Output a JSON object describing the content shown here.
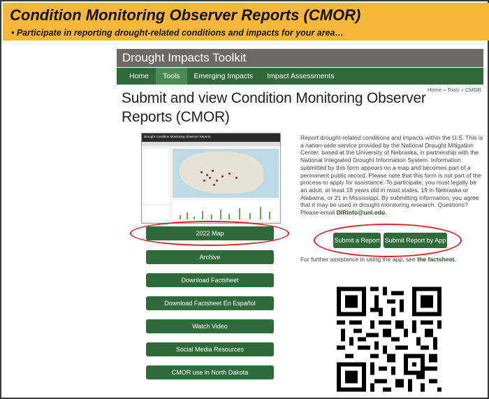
{
  "banner": {
    "title": "Condition Monitoring Observer Reports (CMOR)",
    "bullet": "•  Participate in reporting drought-related conditions and impacts for your area…",
    "color": "#f7b83a"
  },
  "site": {
    "toolkit_title": "Drought Impacts Toolkit",
    "nav": [
      "Home",
      "Tools",
      "Emerging Impacts",
      "Impact Assessments"
    ],
    "active_nav": "Tools",
    "breadcrumb": "Home  »  Tools  »  CMOR",
    "page_title": "Submit and view Condition Monitoring Observer Reports (CMOR)"
  },
  "screenshot": {
    "header": "Drought Condition Monitoring Observer Reports"
  },
  "buttons": [
    "2022 Map",
    "Archive",
    "Download Factsheet",
    "Download Factsheet En Español",
    "Watch Video",
    "Social Media Resources",
    "CMOR use in North Dakota"
  ],
  "description": {
    "text": "Report drought-related conditions and impacts within the U.S. This is a nation-wide service provided by the National Drought Mitigation Center, based at the University of Nebraska, in partnership with the National Integrated Drought Information System. Information submitted by this form appears on a map and becomes part of a permanent public record. Please note that this form is not part of the process to apply for assistance. To participate, you must legally be an adult, at least 18 years old in most states, 19 in Nebraska or Alabama, or 21 in Mississippi. By submitting information, you agree that it may be used in drought monitoring research. Questions? Please email ",
    "email": "DIRinfo@unl.edu",
    "email_suffix": "."
  },
  "report_buttons": {
    "submit": "Submit a Report",
    "submit_app": "Submit Report by App"
  },
  "help": {
    "prefix": "For further assistance in using the app, see ",
    "link": "the factsheet",
    "suffix": "."
  },
  "colors": {
    "nav_green": "#2f6b3a",
    "toolkit_gray": "#6e6967",
    "highlight_red": "#e0202a"
  },
  "icons": [
    "qr-code-icon"
  ]
}
